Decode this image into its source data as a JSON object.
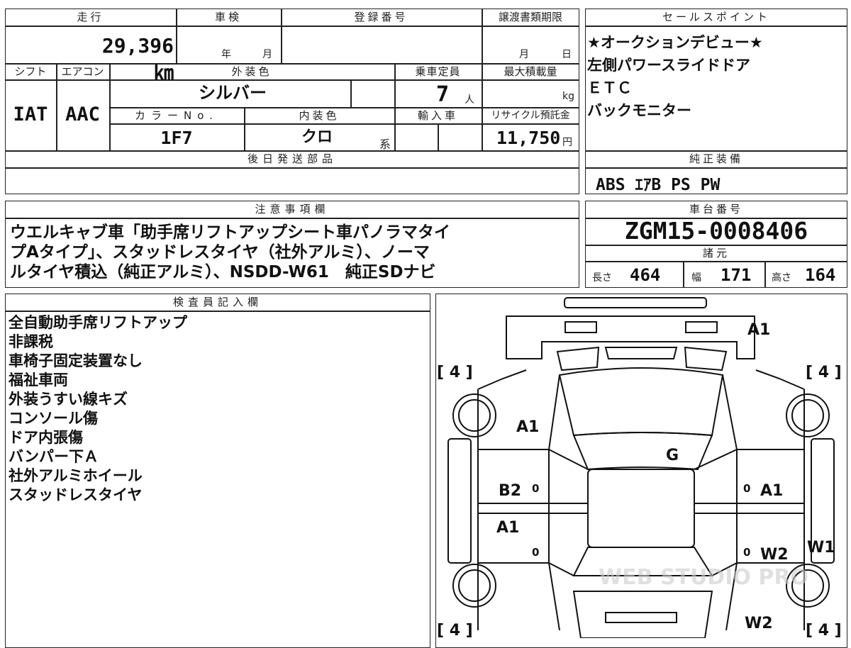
{
  "top_info": {
    "mileage_label": "走行",
    "mileage_value": "29,396 ㎞",
    "inspection_label": "車検",
    "inspection_year": "年",
    "inspection_month": "月",
    "registration_label": "登録番号",
    "transfer_doc_label": "譲渡書類期限",
    "transfer_month": "月",
    "transfer_day": "日",
    "shift_label": "シフト",
    "ac_label": "エアコン",
    "exterior_color_label": "外装色",
    "capacity_label": "乗車定員",
    "max_load_label": "最大積載量",
    "shift_value": "IAT",
    "ac_value": "AAC",
    "exterior_color_value": "シルバー",
    "capacity_value": "7",
    "capacity_unit": "人",
    "load_unit": "kg",
    "color_no_label": "カラーNo.",
    "interior_color_label": "内装色",
    "import_label": "輸入車",
    "recycle_label": "リサイクル預託金",
    "color_no_value": "1F7",
    "interior_color_value": "クロ",
    "interior_suffix": "系",
    "recycle_value": "11,750",
    "recycle_unit": "円",
    "later_parts_label": "後日発送部品"
  },
  "sales_points": {
    "header": "セールスポイント",
    "items": [
      "★オークションデビュー★",
      "左側パワースライドドア",
      "ＥＴＣ",
      "バックモニター"
    ]
  },
  "genuine_equipment": {
    "header": "純正装備",
    "value": "ABS ｴｱB PS PW"
  },
  "notes": {
    "header": "注意事項欄",
    "lines": [
      "ウエルキャブ車「助手席リフトアップシート車パノラマタイ",
      "プAタイプ」、スタッドレスタイヤ（社外アルミ）、ノーマ",
      "ルタイヤ積込（純正アルミ）、NSDD-W61　純正SDナビ"
    ]
  },
  "chassis": {
    "header": "車台番号",
    "value": "ZGM15-0008406"
  },
  "specs": {
    "header": "諸元",
    "length_label": "長さ",
    "length_value": "464",
    "width_label": "幅",
    "width_value": "171",
    "height_label": "高さ",
    "height_value": "164"
  },
  "inspector": {
    "header": "検査員記入欄",
    "items": [
      "全自動助手席リフトアップ",
      "非課税",
      "車椅子固定装置なし",
      "福祉車両",
      "外装うすい線キズ",
      "コンソール傷",
      "ドア内張傷",
      "バンパー下Ａ",
      "社外アルミホイール",
      "スタッドレスタイヤ"
    ]
  },
  "diagram": {
    "tire_fl": "[ 4 ]",
    "tire_fr": "[ 4 ]",
    "tire_rl": "[ 4 ]",
    "tire_rr": "[ 4 ]",
    "mark_front_bumper": "A1",
    "mark_hood_left": "A1",
    "mark_roof": "G",
    "mark_left_front_door": "B2",
    "mark_left_rear_door": "A1",
    "mark_right_front_door": "A1",
    "mark_right_rear_door": "W2",
    "mark_right_quarter": "W1",
    "mark_rear_right": "W2",
    "zero_marks": [
      "0",
      "0",
      "0",
      "0"
    ],
    "watermark": "WEB STUDIO PRO"
  }
}
